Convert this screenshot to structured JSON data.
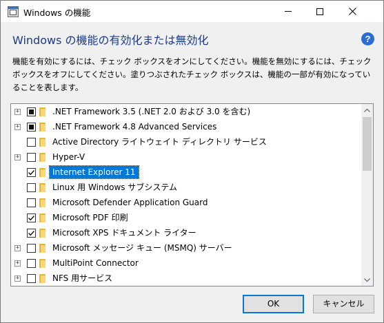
{
  "window": {
    "title": "Windows の機能",
    "controls": {
      "minimize": "minimize",
      "maximize": "maximize",
      "close": "close"
    }
  },
  "heading": "Windows の機能の有効化または無効化",
  "help_icon_glyph": "?",
  "description": "機能を有効にするには、チェック ボックスをオンにしてください。機能を無効にするには、チェック ボックスをオフにしてください。塗りつぶされたチェック ボックスは、機能の一部が有効になっていることを表します。",
  "features": [
    {
      "label": ".NET Framework 3.5 (.NET 2.0 および 3.0 を含む)",
      "expandable": true,
      "state": "partial",
      "selected": false
    },
    {
      "label": ".NET Framework 4.8 Advanced Services",
      "expandable": true,
      "state": "partial",
      "selected": false
    },
    {
      "label": "Active Directory ライトウェイト ディレクトリ サービス",
      "expandable": false,
      "state": "unchecked",
      "selected": false
    },
    {
      "label": "Hyper-V",
      "expandable": true,
      "state": "unchecked",
      "selected": false
    },
    {
      "label": "Internet Explorer 11",
      "expandable": false,
      "state": "checked",
      "selected": true
    },
    {
      "label": "Linux 用 Windows サブシステム",
      "expandable": false,
      "state": "unchecked",
      "selected": false
    },
    {
      "label": "Microsoft Defender Application Guard",
      "expandable": false,
      "state": "unchecked",
      "selected": false
    },
    {
      "label": "Microsoft PDF 印刷",
      "expandable": false,
      "state": "checked",
      "selected": false
    },
    {
      "label": "Microsoft XPS ドキュメント ライター",
      "expandable": false,
      "state": "checked",
      "selected": false
    },
    {
      "label": "Microsoft メッセージ キュー (MSMQ) サーバー",
      "expandable": true,
      "state": "unchecked",
      "selected": false
    },
    {
      "label": "MultiPoint Connector",
      "expandable": true,
      "state": "unchecked",
      "selected": false
    },
    {
      "label": "NFS 用サービス",
      "expandable": true,
      "state": "unchecked",
      "selected": false
    }
  ],
  "buttons": {
    "ok": "OK",
    "cancel": "キャンセル"
  },
  "colors": {
    "accent": "#0078d7",
    "heading": "#1a3a8a",
    "help": "#2a6ed1",
    "folder": "#e8b530"
  }
}
